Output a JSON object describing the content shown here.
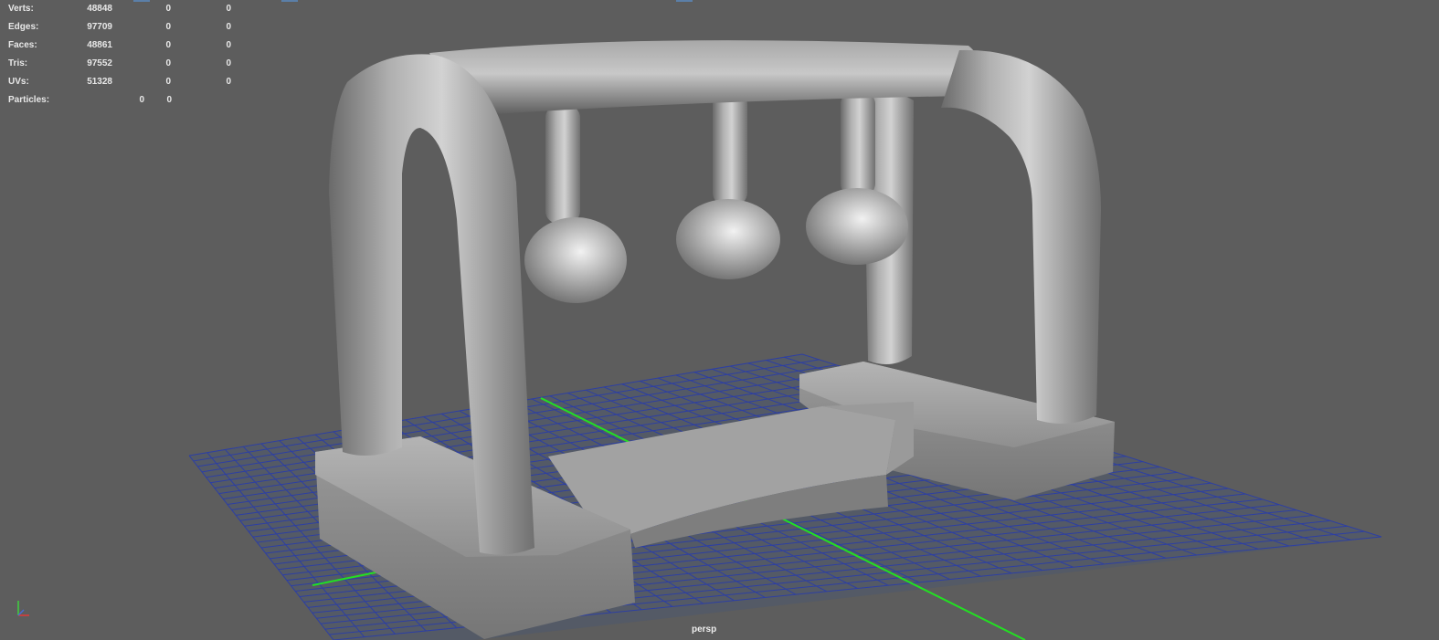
{
  "stats": [
    {
      "label": "Verts:",
      "v1": "48848",
      "v2": "0",
      "v3": "0"
    },
    {
      "label": "Edges:",
      "v1": "97709",
      "v2": "0",
      "v3": "0"
    },
    {
      "label": "Faces:",
      "v1": "48861",
      "v2": "0",
      "v3": "0"
    },
    {
      "label": "Tris:",
      "v1": "97552",
      "v2": "0",
      "v3": "0"
    },
    {
      "label": "UVs:",
      "v1": "51328",
      "v2": "0",
      "v3": "0"
    },
    {
      "label": "Particles:",
      "v1": "0",
      "v2": "0"
    }
  ],
  "camera": {
    "name": "persp"
  },
  "axis_icon": "xyz-axis-gizmo-icon",
  "colors": {
    "background": "#5d5d5d",
    "grid": "#2d3fa3",
    "grid_axis": "#22e022",
    "mesh": "#9b9b9b"
  }
}
